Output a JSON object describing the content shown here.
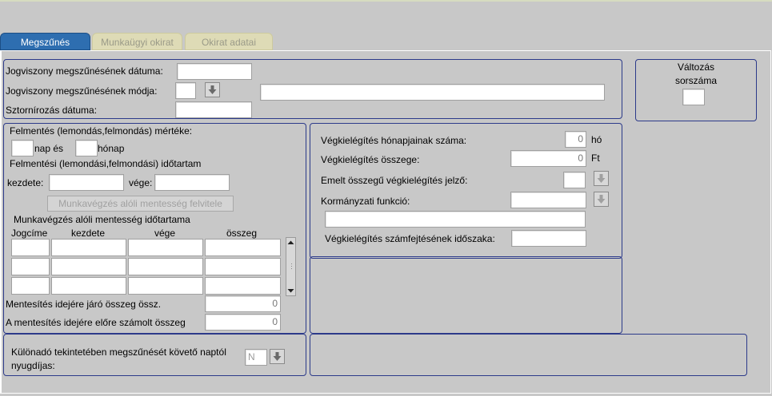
{
  "tabs": [
    {
      "label": "Megszűnés",
      "active": true
    },
    {
      "label": "Munkaügyi okirat",
      "active": false
    },
    {
      "label": "Okirat adatai",
      "active": false
    }
  ],
  "top": {
    "date_label": "Jogviszony megszűnésének dátuma:",
    "date_value": "",
    "mode_label": "Jogviszony megszűnésének módja:",
    "mode_code": "",
    "mode_desc": "",
    "storno_label": "Sztornírozás dátuma:",
    "storno_value": ""
  },
  "change": {
    "label_line1": "Változás",
    "label_line2": "sorszáma",
    "value": ""
  },
  "left": {
    "relief_label": "Felmentés (lemondás,felmondás) mértéke:",
    "day_label": "nap és",
    "month_label": "hónap",
    "period_label": "Felmentési (lemondási,felmondási) időtartam",
    "start_label": "kezdete:",
    "end_label": "vége:",
    "exempt_button": "Munkavégzés alóli mentesség felvitele",
    "exempt_period_label": "Munkavégzés alóli mentesség időtartama",
    "columns": [
      "Jogcíme",
      "kezdete",
      "vége",
      "összeg"
    ],
    "rows": [
      [
        "",
        "",
        "",
        ""
      ],
      [
        "",
        "",
        "",
        ""
      ],
      [
        "",
        "",
        "",
        ""
      ]
    ],
    "sum_label": "Mentesítés idejére járó összeg össz.",
    "sum_value": "0",
    "pre_label": "A mentesítés idejére előre számolt összeg",
    "pre_value": "0"
  },
  "right": {
    "months_label": "Végkielégítés hónapjainak száma:",
    "months_value": "0",
    "months_unit": "hó",
    "amount_label": "Végkielégítés összege:",
    "amount_value": "0",
    "amount_unit": "Ft",
    "flag_label": "Emelt összegű végkielégítés jelző:",
    "flag_value": "",
    "gov_label": "Kormányzati funkció:",
    "gov_value": "",
    "gov_desc": "",
    "period_label": "Végkielégítés számfejtésének időszaka:",
    "period_value": ""
  },
  "bottom": {
    "pension_label_line1": "Különadó tekintetében megszűnését követő naptól",
    "pension_label_line2": "nyugdíjas:",
    "pension_value": "N"
  },
  "icons": {
    "dropdown": "arrow-down-icon",
    "scroll_up": "scroll-up-icon",
    "scroll_down": "scroll-down-icon"
  }
}
